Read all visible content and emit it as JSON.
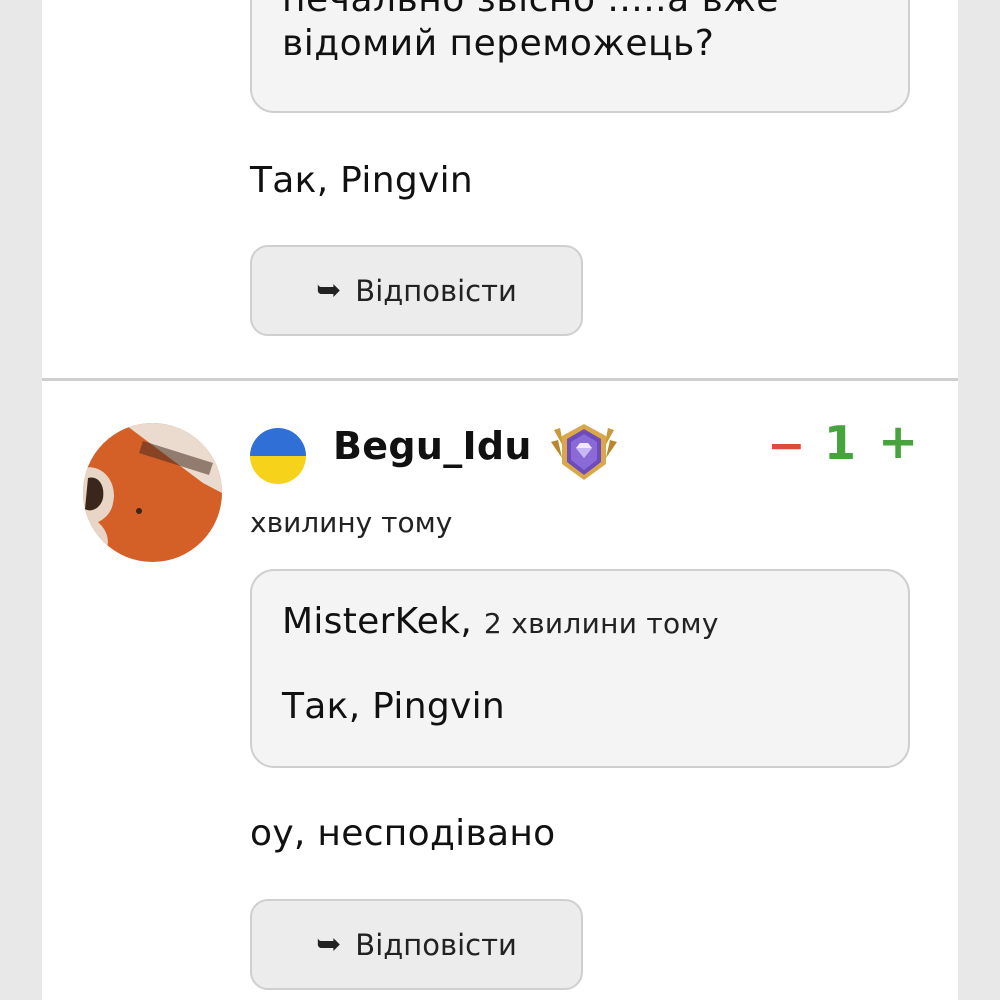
{
  "previous_comment": {
    "quote_text": "печально звісно .....а вже\nвідомий переможець?",
    "text": "Так, Pingvin",
    "reply_label": "Відповісти"
  },
  "comment": {
    "flag_icon": "ukraine-flag-icon",
    "username": "Begu_Idu",
    "badge_icon": "diamond-rank-badge-icon",
    "vote_minus": "−",
    "vote_count": "1",
    "vote_plus": "+",
    "timestamp": "хвилину тому",
    "quote": {
      "author": "MisterKek",
      "separator": ",",
      "time": "2 хвилини тому",
      "text": "Так, Pingvin"
    },
    "text": "оу, несподівано",
    "reply_label": "Відповісти"
  },
  "colors": {
    "vote_minus": "#e04a3c",
    "vote_plus": "#46a33d",
    "flag_blue": "#2f6fd6",
    "flag_yellow": "#f7d21a"
  }
}
